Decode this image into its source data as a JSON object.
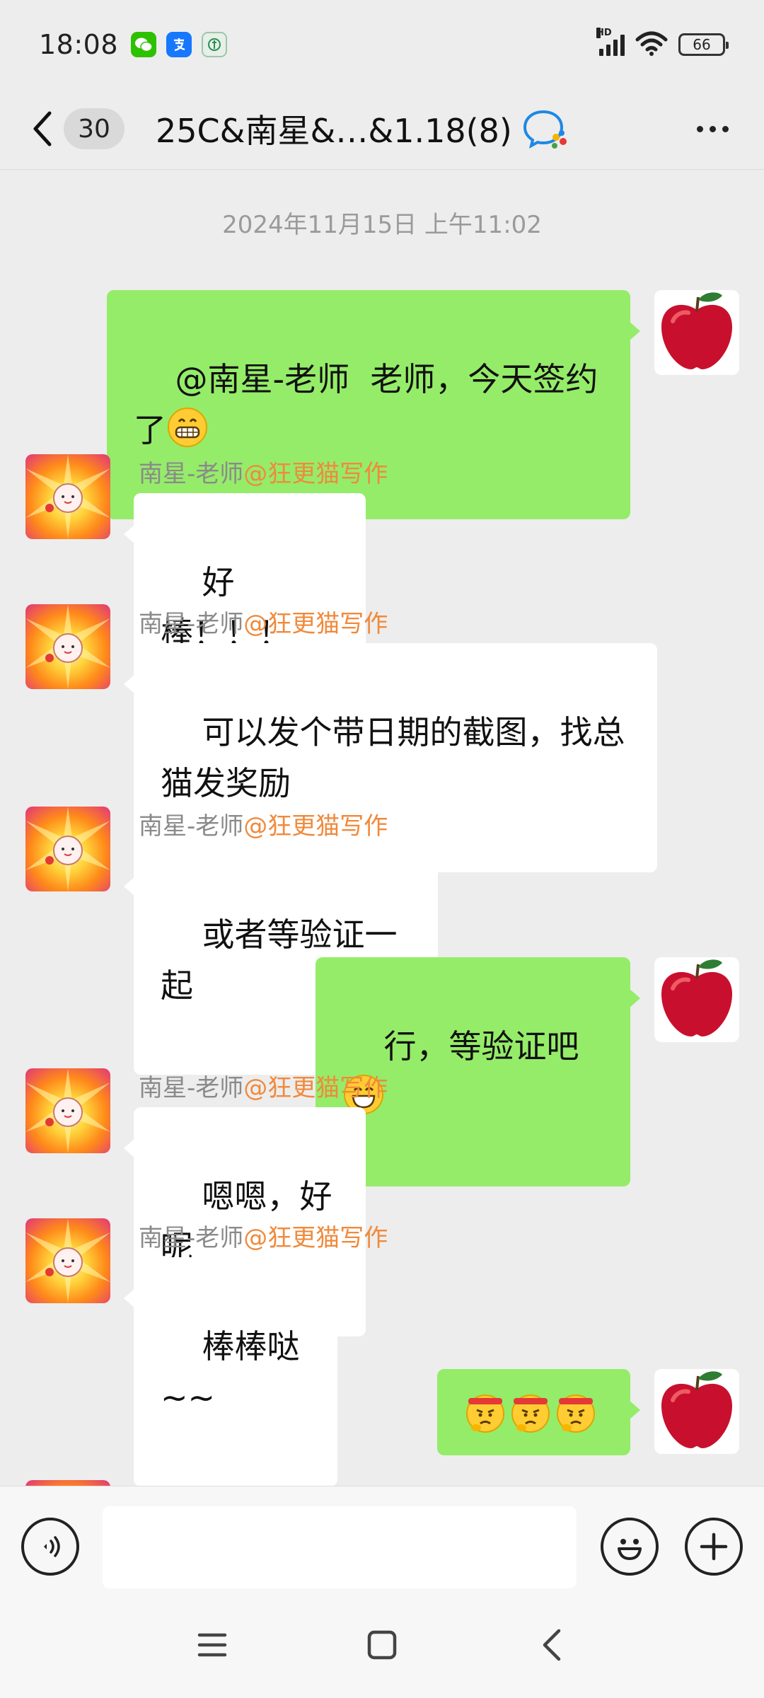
{
  "status_bar": {
    "time": "18:08",
    "battery": "66",
    "signal_label": "HD",
    "app_icons": [
      "wechat-icon",
      "alipay-icon",
      "app-icon"
    ]
  },
  "header": {
    "unread_count": "30",
    "title": "25C&南星&…&1.18(8)"
  },
  "chat": {
    "timestamp": "2024年11月15日 上午11:02",
    "messages": [
      {
        "from": "self",
        "text": "@南星-老师  老师，今天签约了",
        "emoji": "grinning"
      },
      {
        "from": "other",
        "sender": "南星-老师",
        "sender_at": "@狂更猫写作",
        "text": "好棒！！！"
      },
      {
        "from": "other",
        "sender": "南星-老师",
        "sender_at": "@狂更猫写作",
        "text": "可以发个带日期的截图，找总猫发奖励"
      },
      {
        "from": "other",
        "sender": "南星-老师",
        "sender_at": "@狂更猫写作",
        "text": "或者等验证一起"
      },
      {
        "from": "self",
        "text": "行，等验证吧",
        "emoji": "smile"
      },
      {
        "from": "other",
        "sender": "南星-老师",
        "sender_at": "@狂更猫写作",
        "text": "嗯嗯，好呢"
      },
      {
        "from": "other",
        "sender": "南星-老师",
        "sender_at": "@狂更猫写作",
        "text": "棒棒哒 ~~"
      },
      {
        "from": "self",
        "text": "",
        "emoji": "determined-x3"
      }
    ]
  },
  "input": {
    "placeholder": ""
  },
  "colors": {
    "self_bubble": "#95ec69",
    "other_bubble": "#ffffff",
    "background": "#ededed",
    "sender_at": "#f08a3c"
  }
}
